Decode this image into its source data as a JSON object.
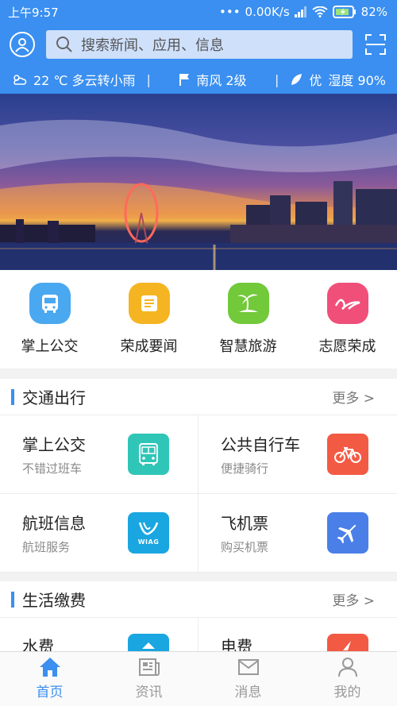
{
  "status": {
    "time": "上午9:57",
    "net_speed": "0.00K/s",
    "battery": "82%"
  },
  "search": {
    "placeholder": "搜索新闻、应用、信息"
  },
  "weather": {
    "temp_desc": "22 ℃ 多云转小雨",
    "wind": "南风 2级",
    "air": "优",
    "humidity": "湿度 90%"
  },
  "quick_apps": [
    {
      "label": "掌上公交",
      "icon": "bus-icon",
      "color": "#4aa8f0"
    },
    {
      "label": "荣成要闻",
      "icon": "news-icon",
      "color": "#f5b522"
    },
    {
      "label": "智慧旅游",
      "icon": "palm-tree-icon",
      "color": "#72c93a"
    },
    {
      "label": "志愿荣成",
      "icon": "volunteer-icon",
      "color": "#f04f7a"
    }
  ],
  "traffic": {
    "title": "交通出行",
    "more": "更多 >",
    "items": [
      {
        "title": "掌上公交",
        "sub": "不错过班车",
        "icon": "bus-icon",
        "color": "#2fc6b8"
      },
      {
        "title": "公共自行车",
        "sub": "便捷骑行",
        "icon": "bicycle-icon",
        "color": "#f25a44"
      },
      {
        "title": "航班信息",
        "sub": "航班服务",
        "icon": "wiag-logo-icon",
        "color": "#1aa6e0",
        "logo_text": "WIAG"
      },
      {
        "title": "飞机票",
        "sub": "购买机票",
        "icon": "airplane-icon",
        "color": "#4a7fe8"
      }
    ]
  },
  "life": {
    "title": "生活缴费",
    "more": "更多 >",
    "items": [
      {
        "title": "水费",
        "icon": "water-icon",
        "color": "#1aa6e0"
      },
      {
        "title": "电费",
        "icon": "electricity-icon",
        "color": "#f25a44"
      }
    ]
  },
  "nav": [
    {
      "label": "首页",
      "icon": "home-icon",
      "active": true
    },
    {
      "label": "资讯",
      "icon": "newspaper-icon",
      "active": false
    },
    {
      "label": "消息",
      "icon": "mail-icon",
      "active": false
    },
    {
      "label": "我的",
      "icon": "user-icon",
      "active": false
    }
  ],
  "colors": {
    "primary": "#3a8ff0"
  }
}
